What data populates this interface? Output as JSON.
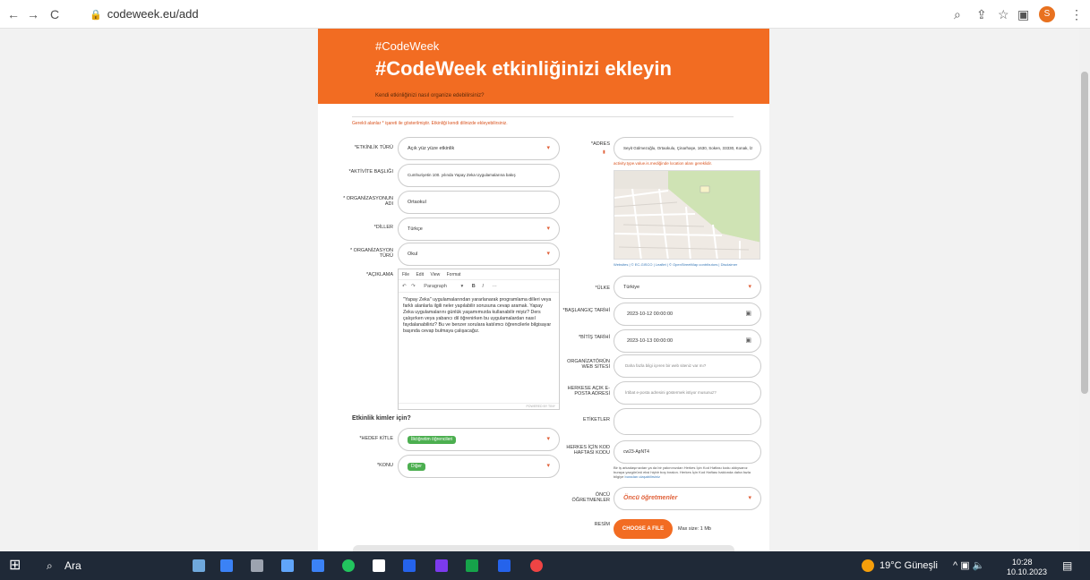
{
  "browser": {
    "back": "←",
    "forward": "→",
    "reload": "C",
    "url": "codeweek.eu/add",
    "profile_initial": "S"
  },
  "banner": {
    "small": "#CodeWeek",
    "title": "#CodeWeek etkinliğinizi ekleyin",
    "link": "Kendi etkinliğinizi nasıl organize edebilirsiniz?"
  },
  "form": {
    "required_note": "Gerekli alanlar * işareti ile gösterilmiştir. Etkinliği kendi dilinizde ekleyebilirsiniz.",
    "activity_type": {
      "label": "*ETKİNLİK TÜRÜ",
      "value": "Açık yüz yüze etkinlik"
    },
    "activity_title": {
      "label": "*AKTİVİTE BAŞLIĞI",
      "value": "Cumhuriyetin 100. yılında Yapay Zeka Uygulamalarına bakış"
    },
    "org_name": {
      "label": "* ORGANİZASYONUN ADI",
      "value": "Ortaokul"
    },
    "languages": {
      "label": "*DİLLER",
      "value": "Türkçe"
    },
    "org_type": {
      "label": "* ORGANİZASYON TÜRÜ",
      "value": "Okul"
    },
    "description": {
      "label": "*AÇIKLAMA",
      "menu": [
        "File",
        "Edit",
        "View",
        "Format"
      ],
      "block": "Paragraph",
      "text": "\"Yapay Zeka\" uygulamalarından yararlanarak programlama dilleri veya farklı alanlarla ilgili neler yapılabilir sorusuna cevap aramak. Yapay Zeka uygulamalarını günlük yaşamımızda kullanabilir miyiz? Ders çalışırken veya yabancı dil öğrenirken bu uygulamalardan nasıl faydalanabiliriz? Bu ve benzer sorulara katılımcı öğrencilerle bilgisayar başında cevap bulmaya çalışacağız.",
      "footer": "POWERED BY TINY"
    },
    "for_whom_heading": "Etkinlik kimler için?",
    "audience": {
      "label": "*HEDEF KİTLE",
      "tag": "İlköğretim öğrencileri"
    },
    "topic": {
      "label": "*KONU",
      "tag": "Diğer"
    },
    "address": {
      "label": "*ADRES",
      "value": "Seyit Gülmezoğlu, Ortaokulu, Çinarhaşe, 1630, Soken, 33330, Konak, İz",
      "error": "activity.type.value.is.mediğinde location alanı gereklidir."
    },
    "map_credit": "Websites | © EC-GISCO | Leaflet | © OpenStreetMap contributors | Disclaimer",
    "country": {
      "label": "*ÜLKE",
      "value": "Türkiye"
    },
    "start": {
      "label": "*BAŞLANGIÇ TARİHİ",
      "value": "2023-10-12 00:00:00"
    },
    "end": {
      "label": "*BİTİŞ TARİHİ",
      "value": "2023-10-13 00:00:00"
    },
    "website": {
      "label": "ORGANİZATÖRÜN WEB SİTESİ",
      "placeholder": "Daha fazla bilgi içeren bir web siteniz var mı?"
    },
    "email": {
      "label": "HERKESE AÇIK E-POSTA ADRESİ",
      "placeholder": "İrtibat e-posta adresini göstermek istiyor musunuz?"
    },
    "tags": {
      "label": "ETİKETLER",
      "value": ""
    },
    "code": {
      "label": "HERKES İÇİN KOD HAFTASI KODU",
      "value": "cw23-ApNT4",
      "help": "Bir iş arkadaşınızdan ya da bir yakınınızdan Herkes İçin Kod Haftası kodu aldıysanız buraya yazgörünü eksi hiçbir boş bırakın. Herkes İçin Kod Haftası hakkında daha fazla bilgiye",
      "help_link": "buradan ulaşabilirsiniz"
    },
    "leading": {
      "label": "ÖNCÜ ÖĞRETMENLER",
      "placeholder": "Öncü öğretmenler"
    },
    "image": {
      "label": "RESİM",
      "button": "CHOOSE A FILE",
      "max": "Max size: 1 Mb"
    }
  },
  "taskbar": {
    "search": "Ara",
    "weather": "19°C Güneşli",
    "time": "10:28",
    "date": "10.10.2023"
  }
}
